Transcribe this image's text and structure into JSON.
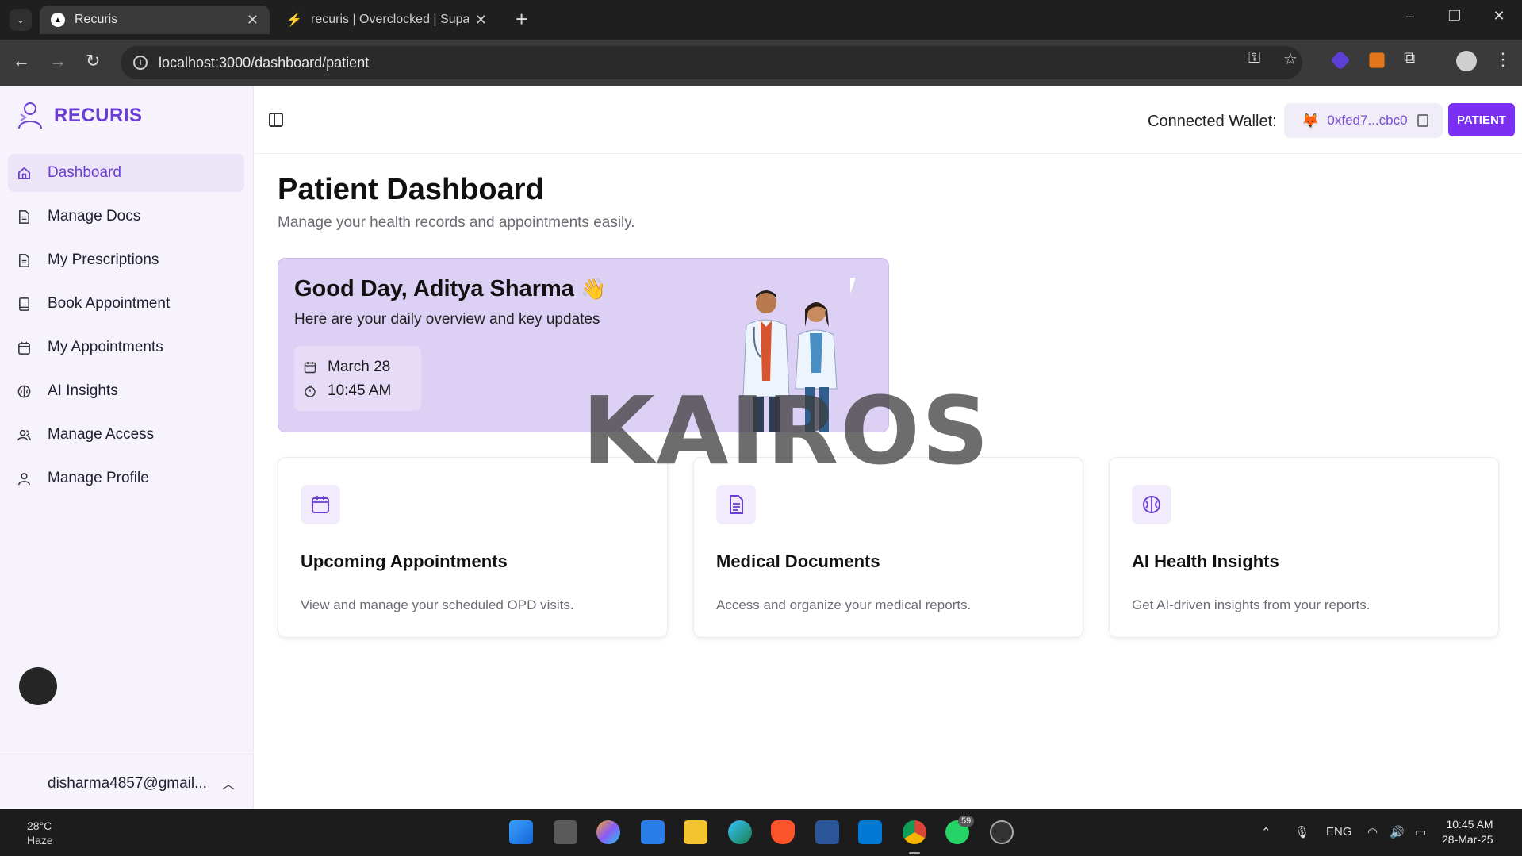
{
  "browser": {
    "tabs": [
      {
        "title": "Recuris",
        "active": true
      },
      {
        "title": "recuris | Overclocked | Supabase",
        "active": false
      }
    ],
    "url": "localhost:3000/dashboard/patient"
  },
  "sidebar": {
    "brand": "RECURIS",
    "items": [
      {
        "label": "Dashboard",
        "icon": "home-icon",
        "active": true
      },
      {
        "label": "Manage Docs",
        "icon": "document-icon"
      },
      {
        "label": "My Prescriptions",
        "icon": "document-icon"
      },
      {
        "label": "Book Appointment",
        "icon": "book-icon"
      },
      {
        "label": "My Appointments",
        "icon": "calendar-icon"
      },
      {
        "label": "AI Insights",
        "icon": "brain-icon"
      },
      {
        "label": "Manage Access",
        "icon": "users-icon"
      },
      {
        "label": "Manage Profile",
        "icon": "user-icon"
      }
    ],
    "user_email": "disharma4857@gmail..."
  },
  "topbar": {
    "wallet_label": "Connected Wallet:",
    "wallet_address": "0xfed7...cbc0",
    "role_label": "PATIENT"
  },
  "page": {
    "title": "Patient Dashboard",
    "subtitle": "Manage your health records and appointments easily."
  },
  "hero": {
    "greeting_prefix": "Good Day, ",
    "user_name": "Aditya Sharma",
    "wave": "👋",
    "subtitle": "Here are your daily overview and key updates",
    "date": "March 28",
    "time": "10:45 AM"
  },
  "watermark": "KAIROS",
  "cards": [
    {
      "title": "Upcoming Appointments",
      "desc": "View and manage your scheduled OPD visits.",
      "icon": "calendar-icon"
    },
    {
      "title": "Medical Documents",
      "desc": "Access and organize your medical reports.",
      "icon": "document-icon"
    },
    {
      "title": "AI Health Insights",
      "desc": "Get AI-driven insights from your reports.",
      "icon": "brain-icon"
    }
  ],
  "taskbar": {
    "weather_temp": "28°C",
    "weather_desc": "Haze",
    "whatsapp_badge": "59",
    "lang": "ENG",
    "time": "10:45 AM",
    "date": "28-Mar-25"
  },
  "colors": {
    "accent": "#6b3fd3",
    "role_button": "#7b2ff2",
    "hero_bg": "#dcd0f5",
    "sidebar_bg": "#f7f3fc"
  }
}
